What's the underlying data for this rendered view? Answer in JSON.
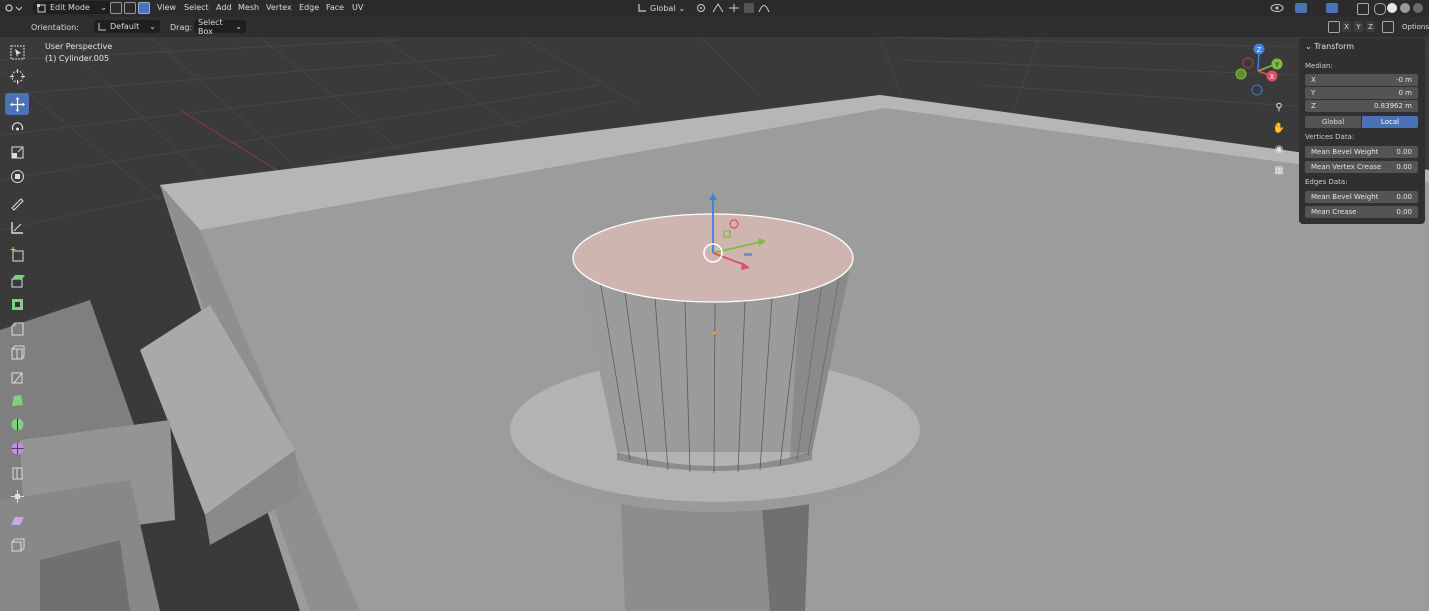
{
  "header": {
    "mode": "Edit Mode",
    "menu": [
      "View",
      "Select",
      "Add",
      "Mesh",
      "Vertex",
      "Edge",
      "Face",
      "UV"
    ],
    "transform_orientation": "Global"
  },
  "tool_header": {
    "orientation_label": "Orientation:",
    "orientation_value": "Default",
    "drag_label": "Drag:",
    "drag_value": "Select Box",
    "axis_x": "X",
    "axis_y": "Y",
    "axis_z": "Z",
    "options_label": "Options"
  },
  "viewport": {
    "view_name": "User Perspective",
    "object_name": "(1) Cylinder.005",
    "gizmo_axes": {
      "z": "Z",
      "y": "Y",
      "x": "X"
    }
  },
  "toolbar": {
    "tools": [
      "select-box",
      "cursor",
      "move",
      "rotate",
      "scale",
      "transform",
      "annotate",
      "measure",
      "add-cube",
      "extrude-region",
      "inset-faces",
      "bevel",
      "loop-cut",
      "knife",
      "poly-build",
      "spin",
      "smooth",
      "edge-slide",
      "shrink-fatten",
      "shear",
      "rip-region"
    ],
    "active_tool": "move"
  },
  "transform_panel": {
    "title": "Transform",
    "median_label": "Median:",
    "fields": [
      {
        "label": "X",
        "value": "-0 m"
      },
      {
        "label": "Y",
        "value": "0 m"
      },
      {
        "label": "Z",
        "value": "0.83962 m"
      }
    ],
    "space_options": [
      "Global",
      "Local"
    ],
    "space_selected": "Local",
    "vertices_data_label": "Vertices Data:",
    "vertices_fields": [
      {
        "label": "Mean Bevel Weight",
        "value": "0.00"
      },
      {
        "label": "Mean Vertex Crease",
        "value": "0.00"
      }
    ],
    "edges_data_label": "Edges Data:",
    "edges_fields": [
      {
        "label": "Mean Bevel Weight",
        "value": "0.00"
      },
      {
        "label": "Mean Crease",
        "value": "0.00"
      }
    ]
  },
  "colors": {
    "accent": "#4a73b7",
    "header_bg": "#2b2b2b",
    "panel_bg": "#303030",
    "selected_face": "#cfb5b0",
    "axis_x": "#e04f5f",
    "axis_y": "#7dbd3c",
    "axis_z": "#3d82e3"
  }
}
